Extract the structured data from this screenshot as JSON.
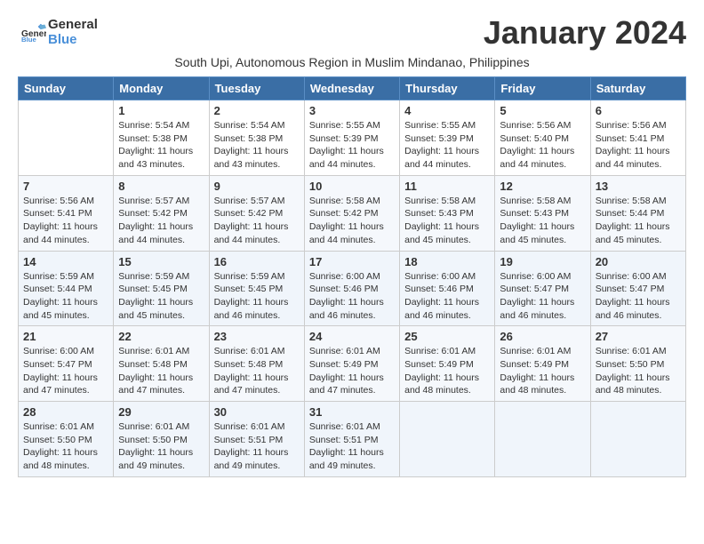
{
  "header": {
    "logo_line1": "General",
    "logo_line2": "Blue",
    "month": "January 2024",
    "subtitle": "South Upi, Autonomous Region in Muslim Mindanao, Philippines"
  },
  "weekdays": [
    "Sunday",
    "Monday",
    "Tuesday",
    "Wednesday",
    "Thursday",
    "Friday",
    "Saturday"
  ],
  "weeks": [
    [
      {
        "day": "",
        "sunrise": "",
        "sunset": "",
        "daylight": ""
      },
      {
        "day": "1",
        "sunrise": "Sunrise: 5:54 AM",
        "sunset": "Sunset: 5:38 PM",
        "daylight": "Daylight: 11 hours and 43 minutes."
      },
      {
        "day": "2",
        "sunrise": "Sunrise: 5:54 AM",
        "sunset": "Sunset: 5:38 PM",
        "daylight": "Daylight: 11 hours and 43 minutes."
      },
      {
        "day": "3",
        "sunrise": "Sunrise: 5:55 AM",
        "sunset": "Sunset: 5:39 PM",
        "daylight": "Daylight: 11 hours and 44 minutes."
      },
      {
        "day": "4",
        "sunrise": "Sunrise: 5:55 AM",
        "sunset": "Sunset: 5:39 PM",
        "daylight": "Daylight: 11 hours and 44 minutes."
      },
      {
        "day": "5",
        "sunrise": "Sunrise: 5:56 AM",
        "sunset": "Sunset: 5:40 PM",
        "daylight": "Daylight: 11 hours and 44 minutes."
      },
      {
        "day": "6",
        "sunrise": "Sunrise: 5:56 AM",
        "sunset": "Sunset: 5:41 PM",
        "daylight": "Daylight: 11 hours and 44 minutes."
      }
    ],
    [
      {
        "day": "7",
        "sunrise": "Sunrise: 5:56 AM",
        "sunset": "Sunset: 5:41 PM",
        "daylight": "Daylight: 11 hours and 44 minutes."
      },
      {
        "day": "8",
        "sunrise": "Sunrise: 5:57 AM",
        "sunset": "Sunset: 5:42 PM",
        "daylight": "Daylight: 11 hours and 44 minutes."
      },
      {
        "day": "9",
        "sunrise": "Sunrise: 5:57 AM",
        "sunset": "Sunset: 5:42 PM",
        "daylight": "Daylight: 11 hours and 44 minutes."
      },
      {
        "day": "10",
        "sunrise": "Sunrise: 5:58 AM",
        "sunset": "Sunset: 5:42 PM",
        "daylight": "Daylight: 11 hours and 44 minutes."
      },
      {
        "day": "11",
        "sunrise": "Sunrise: 5:58 AM",
        "sunset": "Sunset: 5:43 PM",
        "daylight": "Daylight: 11 hours and 45 minutes."
      },
      {
        "day": "12",
        "sunrise": "Sunrise: 5:58 AM",
        "sunset": "Sunset: 5:43 PM",
        "daylight": "Daylight: 11 hours and 45 minutes."
      },
      {
        "day": "13",
        "sunrise": "Sunrise: 5:58 AM",
        "sunset": "Sunset: 5:44 PM",
        "daylight": "Daylight: 11 hours and 45 minutes."
      }
    ],
    [
      {
        "day": "14",
        "sunrise": "Sunrise: 5:59 AM",
        "sunset": "Sunset: 5:44 PM",
        "daylight": "Daylight: 11 hours and 45 minutes."
      },
      {
        "day": "15",
        "sunrise": "Sunrise: 5:59 AM",
        "sunset": "Sunset: 5:45 PM",
        "daylight": "Daylight: 11 hours and 45 minutes."
      },
      {
        "day": "16",
        "sunrise": "Sunrise: 5:59 AM",
        "sunset": "Sunset: 5:45 PM",
        "daylight": "Daylight: 11 hours and 46 minutes."
      },
      {
        "day": "17",
        "sunrise": "Sunrise: 6:00 AM",
        "sunset": "Sunset: 5:46 PM",
        "daylight": "Daylight: 11 hours and 46 minutes."
      },
      {
        "day": "18",
        "sunrise": "Sunrise: 6:00 AM",
        "sunset": "Sunset: 5:46 PM",
        "daylight": "Daylight: 11 hours and 46 minutes."
      },
      {
        "day": "19",
        "sunrise": "Sunrise: 6:00 AM",
        "sunset": "Sunset: 5:47 PM",
        "daylight": "Daylight: 11 hours and 46 minutes."
      },
      {
        "day": "20",
        "sunrise": "Sunrise: 6:00 AM",
        "sunset": "Sunset: 5:47 PM",
        "daylight": "Daylight: 11 hours and 46 minutes."
      }
    ],
    [
      {
        "day": "21",
        "sunrise": "Sunrise: 6:00 AM",
        "sunset": "Sunset: 5:47 PM",
        "daylight": "Daylight: 11 hours and 47 minutes."
      },
      {
        "day": "22",
        "sunrise": "Sunrise: 6:01 AM",
        "sunset": "Sunset: 5:48 PM",
        "daylight": "Daylight: 11 hours and 47 minutes."
      },
      {
        "day": "23",
        "sunrise": "Sunrise: 6:01 AM",
        "sunset": "Sunset: 5:48 PM",
        "daylight": "Daylight: 11 hours and 47 minutes."
      },
      {
        "day": "24",
        "sunrise": "Sunrise: 6:01 AM",
        "sunset": "Sunset: 5:49 PM",
        "daylight": "Daylight: 11 hours and 47 minutes."
      },
      {
        "day": "25",
        "sunrise": "Sunrise: 6:01 AM",
        "sunset": "Sunset: 5:49 PM",
        "daylight": "Daylight: 11 hours and 48 minutes."
      },
      {
        "day": "26",
        "sunrise": "Sunrise: 6:01 AM",
        "sunset": "Sunset: 5:49 PM",
        "daylight": "Daylight: 11 hours and 48 minutes."
      },
      {
        "day": "27",
        "sunrise": "Sunrise: 6:01 AM",
        "sunset": "Sunset: 5:50 PM",
        "daylight": "Daylight: 11 hours and 48 minutes."
      }
    ],
    [
      {
        "day": "28",
        "sunrise": "Sunrise: 6:01 AM",
        "sunset": "Sunset: 5:50 PM",
        "daylight": "Daylight: 11 hours and 48 minutes."
      },
      {
        "day": "29",
        "sunrise": "Sunrise: 6:01 AM",
        "sunset": "Sunset: 5:50 PM",
        "daylight": "Daylight: 11 hours and 49 minutes."
      },
      {
        "day": "30",
        "sunrise": "Sunrise: 6:01 AM",
        "sunset": "Sunset: 5:51 PM",
        "daylight": "Daylight: 11 hours and 49 minutes."
      },
      {
        "day": "31",
        "sunrise": "Sunrise: 6:01 AM",
        "sunset": "Sunset: 5:51 PM",
        "daylight": "Daylight: 11 hours and 49 minutes."
      },
      {
        "day": "",
        "sunrise": "",
        "sunset": "",
        "daylight": ""
      },
      {
        "day": "",
        "sunrise": "",
        "sunset": "",
        "daylight": ""
      },
      {
        "day": "",
        "sunrise": "",
        "sunset": "",
        "daylight": ""
      }
    ]
  ]
}
